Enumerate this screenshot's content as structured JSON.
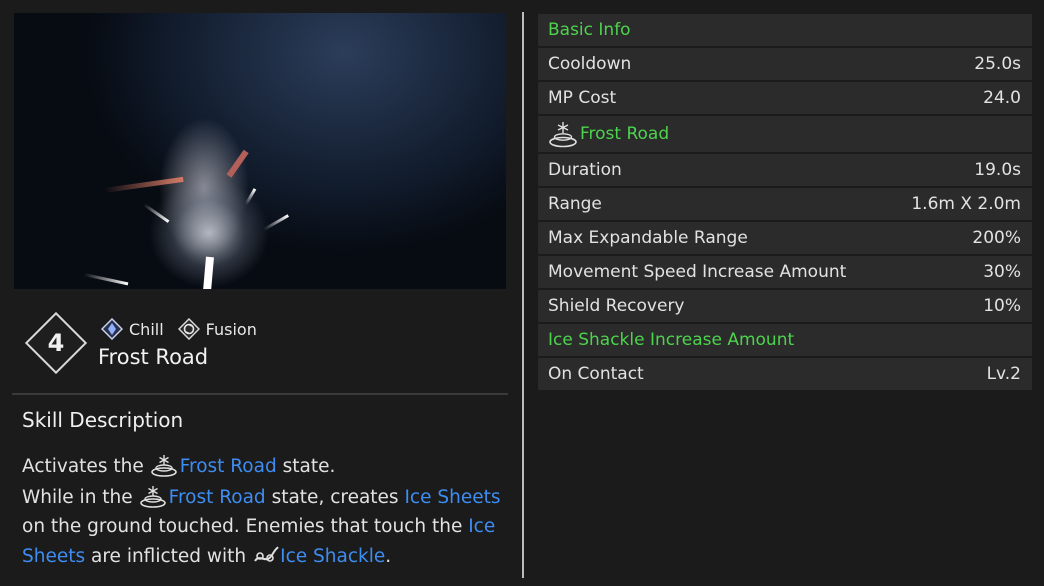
{
  "skill": {
    "level": "4",
    "name": "Frost Road",
    "tags": [
      {
        "label": "Chill",
        "icon": "chill-diamond-icon"
      },
      {
        "label": "Fusion",
        "icon": "fusion-swirl-icon"
      }
    ]
  },
  "description": {
    "title": "Skill Description",
    "line1": {
      "pre": "Activates the",
      "link": "Frost Road",
      "post": "state."
    },
    "line2": {
      "pre": "While in the",
      "link1": "Frost Road",
      "mid1": "state, creates",
      "link2": "Ice Sheets",
      "mid2": "on the ground touched. Enemies that touch the",
      "link3": "Ice Sheets",
      "mid3": "are inflicted with",
      "link4": "Ice Shackle",
      "end": "."
    }
  },
  "stats": {
    "basic_header": "Basic Info",
    "cooldown": {
      "label": "Cooldown",
      "value": "25.0s"
    },
    "mp_cost": {
      "label": "MP Cost",
      "value": "24.0"
    },
    "frost_header": "Frost Road",
    "duration": {
      "label": "Duration",
      "value": "19.0s"
    },
    "range": {
      "label": "Range",
      "value": "1.6m X 2.0m"
    },
    "max_range": {
      "label": "Max Expandable Range",
      "value": "200%"
    },
    "move_speed": {
      "label": "Movement Speed Increase Amount",
      "value": "30%"
    },
    "shield": {
      "label": "Shield Recovery",
      "value": "10%"
    },
    "shackle_header": "Ice Shackle Increase Amount",
    "on_contact": {
      "label": "On Contact",
      "value": "Lv.2"
    }
  },
  "colors": {
    "link": "#3d8df2",
    "header_green": "#4cd44c",
    "row_bg": "#2b2b2b",
    "page_bg": "#1b1b1b"
  }
}
